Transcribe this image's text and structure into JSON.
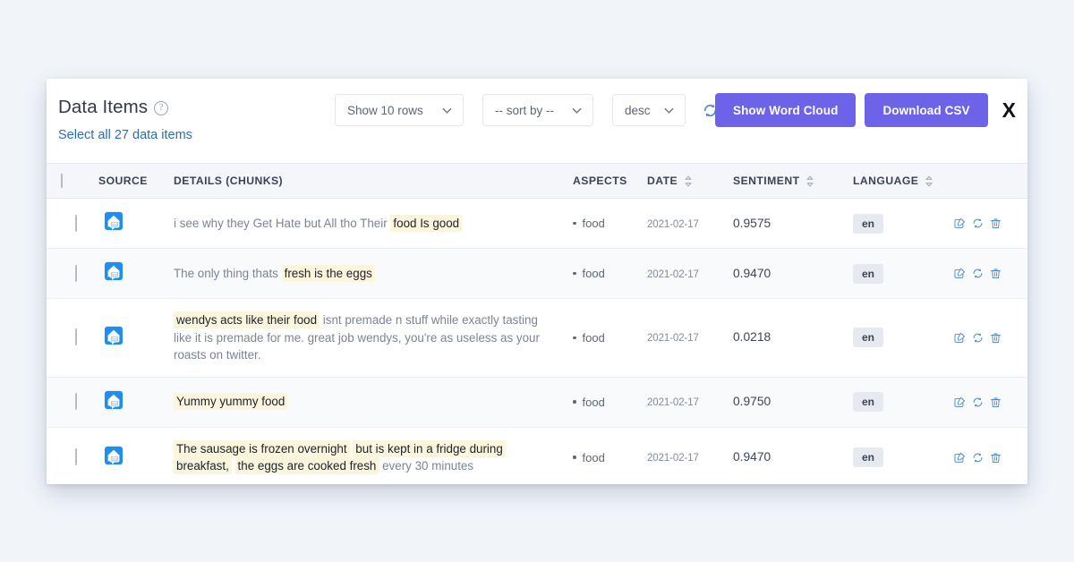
{
  "header": {
    "title": "Data Items",
    "help_icon": "help-circle-icon",
    "select_all_label": "Select all 27 data items"
  },
  "toolbar": {
    "rows_select": {
      "value": "Show 10 rows",
      "icon": "chevron-down-icon"
    },
    "sort_select": {
      "value": "-- sort by --",
      "icon": "chevron-down-icon"
    },
    "direction_select": {
      "value": "desc",
      "icon": "chevron-down-icon"
    },
    "refresh_icon": "refresh-icon"
  },
  "actions": {
    "word_cloud_label": "Show Word Cloud",
    "download_csv_label": "Download CSV",
    "close_label": "X",
    "accent_color": "#6c63e8"
  },
  "table": {
    "columns": [
      {
        "key": "check",
        "label": ""
      },
      {
        "key": "source",
        "label": "SOURCE",
        "sortable": false
      },
      {
        "key": "details",
        "label": "DETAILS (CHUNKS)",
        "sortable": false
      },
      {
        "key": "aspects",
        "label": "ASPECTS",
        "sortable": false
      },
      {
        "key": "date",
        "label": "DATE",
        "sortable": true
      },
      {
        "key": "sentiment",
        "label": "SENTIMENT",
        "sortable": true
      },
      {
        "key": "language",
        "label": "LANGUAGE",
        "sortable": true
      }
    ],
    "row_actions": [
      "edit-icon",
      "reprocess-icon",
      "delete-icon"
    ],
    "source_icon": "social-post-icon",
    "rows": [
      {
        "segments": [
          {
            "text": "i see why they Get Hate but All tho Their ",
            "highlight": false
          },
          {
            "text": "food Is good",
            "highlight": true
          }
        ],
        "aspect": "food",
        "date": "2021-02-17",
        "sentiment": "0.9575",
        "language": "en"
      },
      {
        "segments": [
          {
            "text": "The only thing thats ",
            "highlight": false
          },
          {
            "text": "fresh is the eggs",
            "highlight": true
          }
        ],
        "aspect": "food",
        "date": "2021-02-17",
        "sentiment": "0.9470",
        "language": "en"
      },
      {
        "segments": [
          {
            "text": "wendys acts like their food",
            "highlight": true
          },
          {
            "text": " isnt premade n stuff while exactly tasting like it is premade for me. great job wendys, you're as useless as your roasts on twitter.",
            "highlight": false
          }
        ],
        "aspect": "food",
        "date": "2021-02-17",
        "sentiment": "0.0218",
        "language": "en"
      },
      {
        "segments": [
          {
            "text": "Yummy yummy food",
            "highlight": true
          }
        ],
        "aspect": "food",
        "date": "2021-02-17",
        "sentiment": "0.9750",
        "language": "en"
      },
      {
        "segments": [
          {
            "text": "The sausage is frozen overnight",
            "highlight": true
          },
          {
            "text": " ",
            "highlight": false
          },
          {
            "text": "but is kept in a fridge during breakfast,",
            "highlight": true
          },
          {
            "text": " ",
            "highlight": false
          },
          {
            "text": "the eggs are cooked fresh",
            "highlight": true
          },
          {
            "text": " every 30 minutes",
            "highlight": false
          }
        ],
        "aspect": "food",
        "date": "2021-02-17",
        "sentiment": "0.9470",
        "language": "en"
      }
    ]
  }
}
